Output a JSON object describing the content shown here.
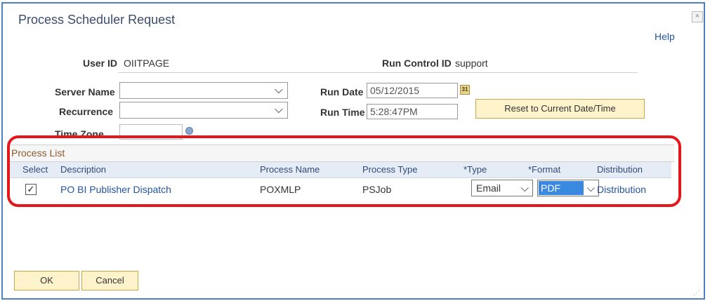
{
  "dialog": {
    "title": "Process Scheduler Request",
    "close_icon": "×",
    "help": "Help"
  },
  "header": {
    "user_id_label": "User ID",
    "user_id_value": "OIITPAGE",
    "run_control_label": "Run Control ID",
    "run_control_value": "support"
  },
  "form": {
    "server_name_label": "Server Name",
    "server_name_value": "",
    "recurrence_label": "Recurrence",
    "recurrence_value": "",
    "time_zone_label": "Time Zone",
    "time_zone_value": "",
    "run_date_label": "Run Date",
    "run_date_value": "05/12/2015",
    "run_time_label": "Run Time",
    "run_time_value": "5:28:47PM",
    "reset_button": "Reset to Current Date/Time"
  },
  "process_list": {
    "title": "Process List",
    "columns": [
      "Select",
      "Description",
      "Process Name",
      "Process Type",
      "*Type",
      "*Format",
      "Distribution"
    ],
    "rows": [
      {
        "selected": true,
        "check": "✓",
        "description": "PO BI Publisher Dispatch",
        "process_name": "POXMLP",
        "process_type": "PSJob",
        "type": "Email",
        "format": "PDF",
        "distribution": "Distribution"
      }
    ]
  },
  "footer": {
    "ok": "OK",
    "cancel": "Cancel"
  },
  "colors": {
    "accent_border": "#4f7fc4",
    "highlight": "#e5161c",
    "button_bg": "#fff3cc"
  }
}
